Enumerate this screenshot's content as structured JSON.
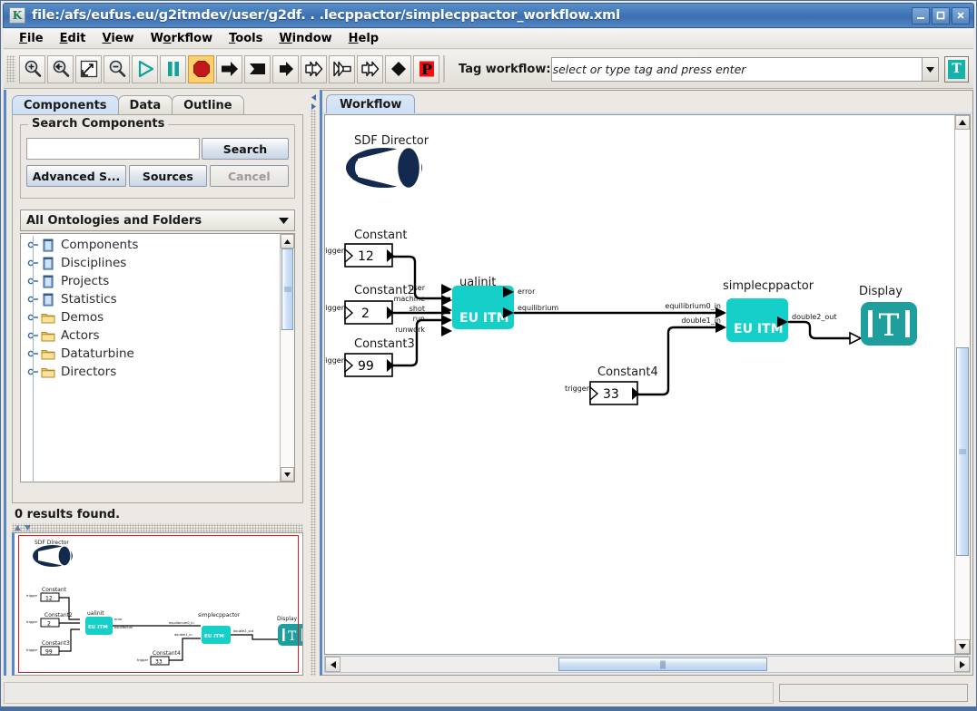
{
  "window": {
    "title": "file:/afs/eufus.eu/g2itmdev/user/g2df. . .lecppactor/simplecppactor_workflow.xml",
    "app_icon_letter": "K",
    "minimize_label": "_",
    "maximize_label": "❐",
    "close_label": "✕",
    "titlebar_color": "#3f76b8"
  },
  "menubar": {
    "items": [
      {
        "name": "file",
        "prefix": "F",
        "rest": "ile"
      },
      {
        "name": "edit",
        "prefix": "E",
        "rest": "dit"
      },
      {
        "name": "view",
        "prefix": "V",
        "rest": "iew"
      },
      {
        "name": "workflow",
        "prefix": "W",
        "rest": "orkflow"
      },
      {
        "name": "tools",
        "prefix": "T",
        "rest": "ools"
      },
      {
        "name": "window",
        "prefix": "W",
        "rest": "indow"
      },
      {
        "name": "help",
        "prefix": "H",
        "rest": "elp"
      }
    ]
  },
  "toolbar": {
    "buttons": [
      {
        "name": "zoom-in-icon",
        "icon": "magnifier-plus",
        "selected": false
      },
      {
        "name": "zoom-reset-icon",
        "icon": "magnifier-back",
        "selected": false
      },
      {
        "name": "zoom-fit-icon",
        "icon": "fit-box",
        "selected": false
      },
      {
        "name": "zoom-out-icon",
        "icon": "magnifier-minus",
        "selected": false
      },
      {
        "name": "run-icon",
        "icon": "play",
        "selected": false
      },
      {
        "name": "pause-icon",
        "icon": "pause",
        "selected": false
      },
      {
        "name": "stop-icon",
        "icon": "stop-octagon",
        "selected": true
      },
      {
        "name": "step-icon",
        "icon": "arrow-right",
        "selected": false
      },
      {
        "name": "flag-icon",
        "icon": "flag-right",
        "selected": false
      },
      {
        "name": "arrow-solid-icon",
        "icon": "arrow-right-2",
        "selected": false
      },
      {
        "name": "fast-forward-icon",
        "icon": "double-chevron",
        "selected": false
      },
      {
        "name": "step-over-icon",
        "icon": "double-chevron-2",
        "selected": false
      },
      {
        "name": "step-into-icon",
        "icon": "double-chevron-3",
        "selected": false
      },
      {
        "name": "diamond-icon",
        "icon": "diamond",
        "selected": false
      },
      {
        "name": "provenance-icon",
        "icon": "letter-p-red",
        "selected": false
      }
    ],
    "tag_label": "Tag workflow:",
    "tag_placeholder": "select or type tag and press enter",
    "tag_value": "",
    "tag_button_letter": "T",
    "accent_teal": "#15b2aa",
    "stop_color": "#c21a1a",
    "select_color": "#ffcf6b"
  },
  "sidebar": {
    "tabs": [
      {
        "name": "components",
        "label": "Components",
        "active": true
      },
      {
        "name": "data",
        "label": "Data",
        "active": false
      },
      {
        "name": "outline",
        "label": "Outline",
        "active": false
      }
    ],
    "search_group_title": "Search Components",
    "search_input_value": "",
    "buttons": {
      "search": "Search",
      "advanced": "Advanced S...",
      "sources": "Sources",
      "cancel": "Cancel"
    },
    "ontology_select": "All Ontologies and Folders",
    "tree": [
      {
        "label": "Components",
        "icon": "ontology-icon"
      },
      {
        "label": "Disciplines",
        "icon": "ontology-icon"
      },
      {
        "label": "Projects",
        "icon": "ontology-icon"
      },
      {
        "label": "Statistics",
        "icon": "ontology-icon"
      },
      {
        "label": "Demos",
        "icon": "folder-icon"
      },
      {
        "label": "Actors",
        "icon": "folder-icon"
      },
      {
        "label": "Dataturbine",
        "icon": "folder-icon"
      },
      {
        "label": "Directors",
        "icon": "folder-icon"
      }
    ],
    "results_text": "0 results found."
  },
  "canvas": {
    "tab_label": "Workflow",
    "director": {
      "name": "SDF Director",
      "label": "SDF Director"
    },
    "constants": [
      {
        "name": "Constant",
        "label": "Constant",
        "value": "12",
        "trigger": "trigger"
      },
      {
        "name": "Constant2",
        "label": "Constant2",
        "value": "2",
        "trigger": "trigger"
      },
      {
        "name": "Constant3",
        "label": "Constant3",
        "value": "99",
        "trigger": "trigger"
      },
      {
        "name": "Constant4",
        "label": "Constant4",
        "value": "33",
        "trigger": "trigger"
      }
    ],
    "actors": [
      {
        "name": "ualinit",
        "label": "ualinit",
        "body_text": "EU ITM",
        "inputs": [
          "user",
          "machine",
          "shot",
          "run",
          "runwork"
        ],
        "outputs": [
          "error",
          "equilibrium"
        ],
        "color": "#15d0c8"
      },
      {
        "name": "simplecppactor",
        "label": "simplecppactor",
        "body_text": "EU ITM",
        "inputs": [
          "equilibrium0_in",
          "double1_in"
        ],
        "outputs": [
          "double2_out"
        ],
        "color": "#15d0c8"
      },
      {
        "name": "Display",
        "label": "Display",
        "body_text": "T",
        "inputs": [],
        "outputs": [],
        "color": "#1f9e9e"
      }
    ]
  },
  "statusbar": {
    "message": "",
    "mini_field_value": ""
  }
}
